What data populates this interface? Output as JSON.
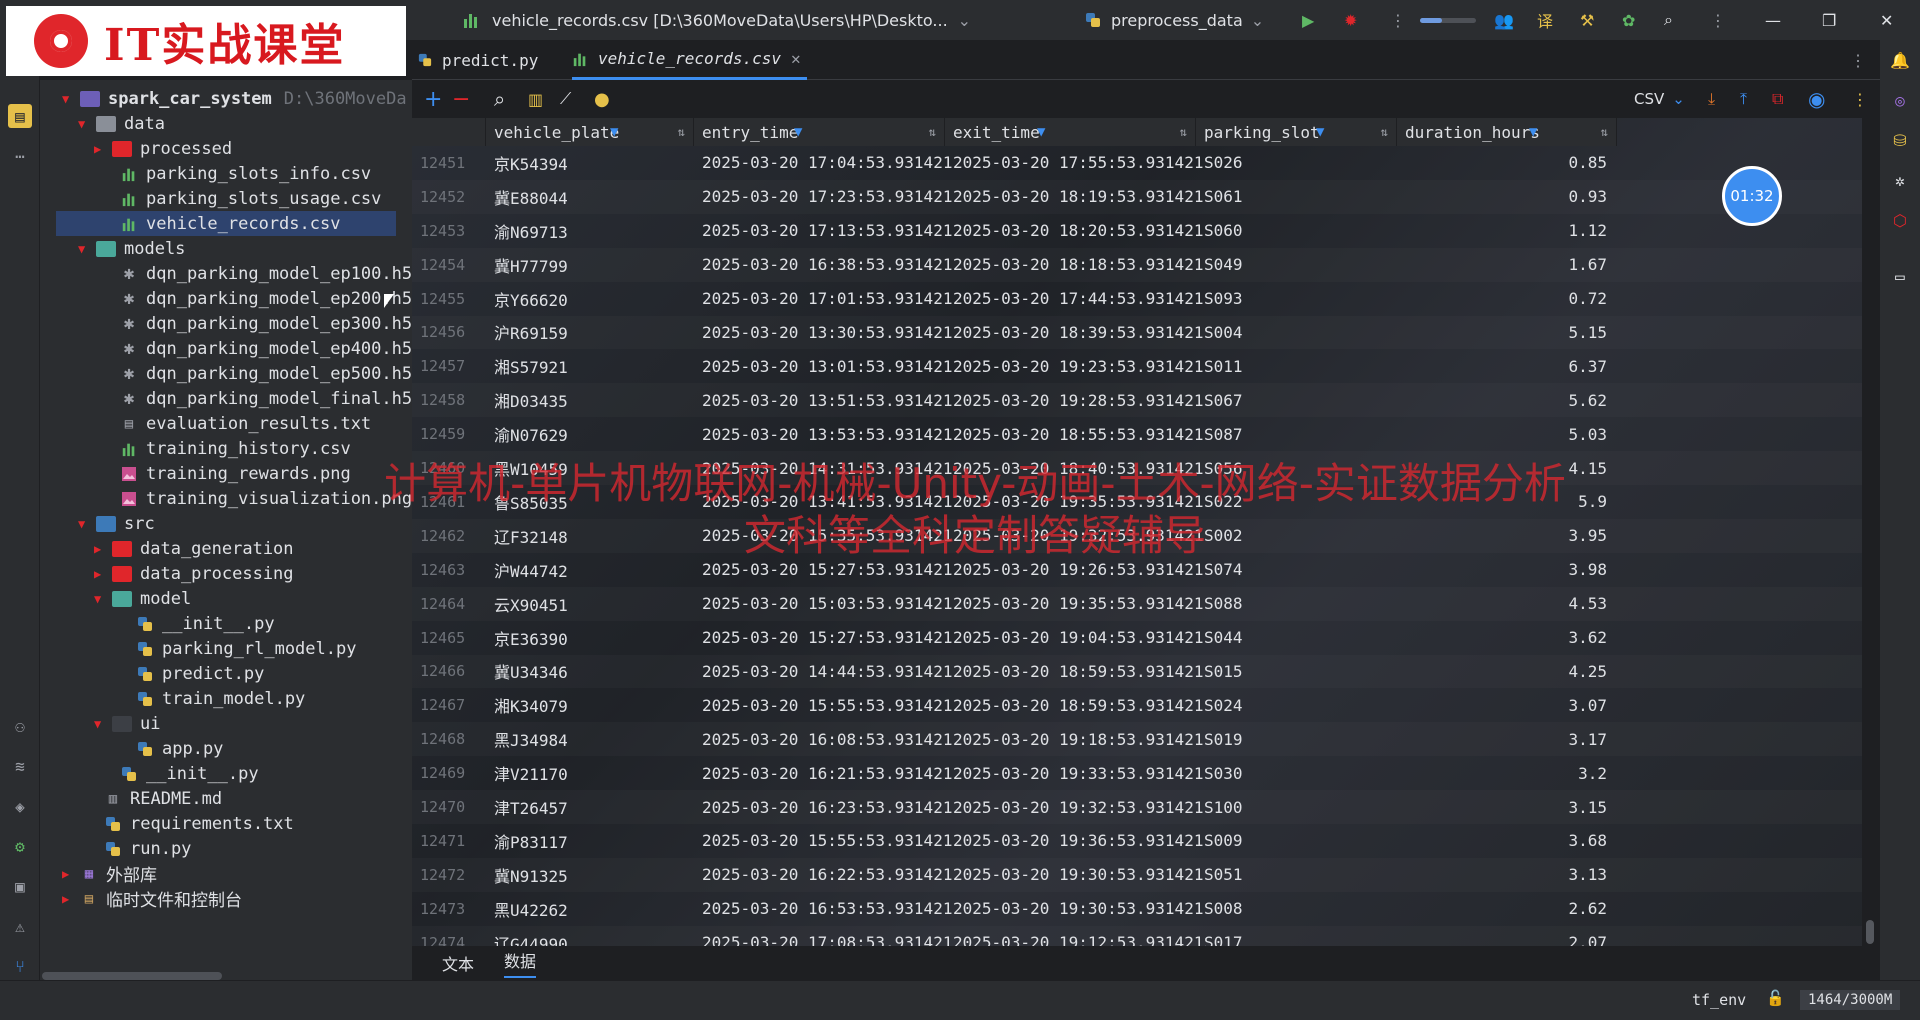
{
  "titlebar": {
    "file_title": "vehicle_records.csv [D:\\360MoveData\\Users\\HP\\Deskto...",
    "run_config": "preprocess_data",
    "brand_text": "IT实战课堂"
  },
  "project": {
    "root_name": "spark_car_system",
    "root_path": "D:\\360MoveDa",
    "items": [
      {
        "label": "data",
        "depth": 1,
        "kind": "folder-plain",
        "arrow": "down"
      },
      {
        "label": "processed",
        "depth": 2,
        "kind": "folder-red",
        "arrow": "right"
      },
      {
        "label": "parking_slots_info.csv",
        "depth": 3,
        "kind": "csv"
      },
      {
        "label": "parking_slots_usage.csv",
        "depth": 3,
        "kind": "csv"
      },
      {
        "label": "vehicle_records.csv",
        "depth": 3,
        "kind": "csv",
        "selected": true
      },
      {
        "label": "models",
        "depth": 1,
        "kind": "folder-teal",
        "arrow": "down"
      },
      {
        "label": "dqn_parking_model_ep100.h5",
        "depth": 3,
        "kind": "h5"
      },
      {
        "label": "dqn_parking_model_ep200.h5",
        "depth": 3,
        "kind": "h5"
      },
      {
        "label": "dqn_parking_model_ep300.h5",
        "depth": 3,
        "kind": "h5"
      },
      {
        "label": "dqn_parking_model_ep400.h5",
        "depth": 3,
        "kind": "h5"
      },
      {
        "label": "dqn_parking_model_ep500.h5",
        "depth": 3,
        "kind": "h5"
      },
      {
        "label": "dqn_parking_model_final.h5",
        "depth": 3,
        "kind": "h5"
      },
      {
        "label": "evaluation_results.txt",
        "depth": 3,
        "kind": "txt"
      },
      {
        "label": "training_history.csv",
        "depth": 3,
        "kind": "csv"
      },
      {
        "label": "training_rewards.png",
        "depth": 3,
        "kind": "png"
      },
      {
        "label": "training_visualization.png",
        "depth": 3,
        "kind": "png"
      },
      {
        "label": "src",
        "depth": 1,
        "kind": "folder-src",
        "arrow": "down"
      },
      {
        "label": "data_generation",
        "depth": 2,
        "kind": "folder-red",
        "arrow": "right"
      },
      {
        "label": "data_processing",
        "depth": 2,
        "kind": "folder-red",
        "arrow": "right"
      },
      {
        "label": "model",
        "depth": 2,
        "kind": "folder-teal",
        "arrow": "down"
      },
      {
        "label": "__init__.py",
        "depth": 4,
        "kind": "py"
      },
      {
        "label": "parking_rl_model.py",
        "depth": 4,
        "kind": "py"
      },
      {
        "label": "predict.py",
        "depth": 4,
        "kind": "py"
      },
      {
        "label": "train_model.py",
        "depth": 4,
        "kind": "py"
      },
      {
        "label": "ui",
        "depth": 2,
        "kind": "folder-dark",
        "arrow": "down"
      },
      {
        "label": "app.py",
        "depth": 4,
        "kind": "py"
      },
      {
        "label": "__init__.py",
        "depth": 3,
        "kind": "py"
      },
      {
        "label": "README.md",
        "depth": 2,
        "kind": "md"
      },
      {
        "label": "requirements.txt",
        "depth": 2,
        "kind": "py"
      },
      {
        "label": "run.py",
        "depth": 2,
        "kind": "py"
      },
      {
        "label": "外部库",
        "depth": 0,
        "kind": "lib",
        "arrow": "right"
      },
      {
        "label": "临时文件和控制台",
        "depth": 0,
        "kind": "scratch",
        "arrow": "right"
      }
    ]
  },
  "tabs": [
    {
      "label": "predict.py",
      "active": false
    },
    {
      "label": "vehicle_records.csv",
      "active": true
    }
  ],
  "toolbar": {
    "format_label": "CSV"
  },
  "table": {
    "columns": [
      "vehicle_plate",
      "entry_time",
      "exit_time",
      "parking_slot",
      "duration_hours"
    ],
    "rows": [
      [
        "12451",
        "京K54394",
        "2025-03-20 17:04:53.931421",
        "2025-03-20 17:55:53.931421",
        "S026",
        "0.85"
      ],
      [
        "12452",
        "冀E88044",
        "2025-03-20 17:23:53.931421",
        "2025-03-20 18:19:53.931421",
        "S061",
        "0.93"
      ],
      [
        "12453",
        "渝N69713",
        "2025-03-20 17:13:53.931421",
        "2025-03-20 18:20:53.931421",
        "S060",
        "1.12"
      ],
      [
        "12454",
        "冀H77799",
        "2025-03-20 16:38:53.931421",
        "2025-03-20 18:18:53.931421",
        "S049",
        "1.67"
      ],
      [
        "12455",
        "京Y66620",
        "2025-03-20 17:01:53.931421",
        "2025-03-20 17:44:53.931421",
        "S093",
        "0.72"
      ],
      [
        "12456",
        "沪R69159",
        "2025-03-20 13:30:53.931421",
        "2025-03-20 18:39:53.931421",
        "S004",
        "5.15"
      ],
      [
        "12457",
        "湘S57921",
        "2025-03-20 13:01:53.931421",
        "2025-03-20 19:23:53.931421",
        "S011",
        "6.37"
      ],
      [
        "12458",
        "湘D03435",
        "2025-03-20 13:51:53.931421",
        "2025-03-20 19:28:53.931421",
        "S067",
        "5.62"
      ],
      [
        "12459",
        "渝N07629",
        "2025-03-20 13:53:53.931421",
        "2025-03-20 18:55:53.931421",
        "S087",
        "5.03"
      ],
      [
        "12460",
        "黑W10459",
        "2025-03-20 14:31:53.931421",
        "2025-03-20 18:40:53.931421",
        "S056",
        "4.15"
      ],
      [
        "12461",
        "鲁S85035",
        "2025-03-20 13:41:53.931421",
        "2025-03-20 19:35:53.931421",
        "S022",
        "5.9"
      ],
      [
        "12462",
        "辽F32148",
        "2025-03-20 15:35:53.931421",
        "2025-03-20 19:32:53.931421",
        "S002",
        "3.95"
      ],
      [
        "12463",
        "沪W44742",
        "2025-03-20 15:27:53.931421",
        "2025-03-20 19:26:53.931421",
        "S074",
        "3.98"
      ],
      [
        "12464",
        "云X90451",
        "2025-03-20 15:03:53.931421",
        "2025-03-20 19:35:53.931421",
        "S088",
        "4.53"
      ],
      [
        "12465",
        "京E36390",
        "2025-03-20 15:27:53.931421",
        "2025-03-20 19:04:53.931421",
        "S044",
        "3.62"
      ],
      [
        "12466",
        "冀U34346",
        "2025-03-20 14:44:53.931421",
        "2025-03-20 18:59:53.931421",
        "S015",
        "4.25"
      ],
      [
        "12467",
        "湘K34079",
        "2025-03-20 15:55:53.931421",
        "2025-03-20 18:59:53.931421",
        "S024",
        "3.07"
      ],
      [
        "12468",
        "黑J34984",
        "2025-03-20 16:08:53.931421",
        "2025-03-20 19:18:53.931421",
        "S019",
        "3.17"
      ],
      [
        "12469",
        "津V21170",
        "2025-03-20 16:21:53.931421",
        "2025-03-20 19:33:53.931421",
        "S030",
        "3.2"
      ],
      [
        "12470",
        "津T26457",
        "2025-03-20 16:23:53.931421",
        "2025-03-20 19:32:53.931421",
        "S100",
        "3.15"
      ],
      [
        "12471",
        "渝P83117",
        "2025-03-20 15:55:53.931421",
        "2025-03-20 19:36:53.931421",
        "S009",
        "3.68"
      ],
      [
        "12472",
        "冀N91325",
        "2025-03-20 16:22:53.931421",
        "2025-03-20 19:30:53.931421",
        "S051",
        "3.13"
      ],
      [
        "12473",
        "黑U42262",
        "2025-03-20 16:53:53.931421",
        "2025-03-20 19:30:53.931421",
        "S008",
        "2.62"
      ],
      [
        "12474",
        "辽G44990",
        "2025-03-20 17:08:53.931421",
        "2025-03-20 19:12:53.931421",
        "S017",
        "2.07"
      ]
    ]
  },
  "view_tabs": {
    "text": "文本",
    "data": "数据"
  },
  "overlay": {
    "timer": "01:32",
    "watermark_line1": "计算机-单片机物联网-机械-Unity-动画-土木-网络-实证数据分析",
    "watermark_line2": "文科等全科定制答疑辅导"
  },
  "status": {
    "env": "tf_env",
    "memory": "1464/3000M"
  },
  "colors": {
    "accent": "#3d8ef0",
    "bg": "#1e1f22",
    "panel": "#2b2d30",
    "selection": "#2e436e",
    "watermark": "#d62830"
  }
}
